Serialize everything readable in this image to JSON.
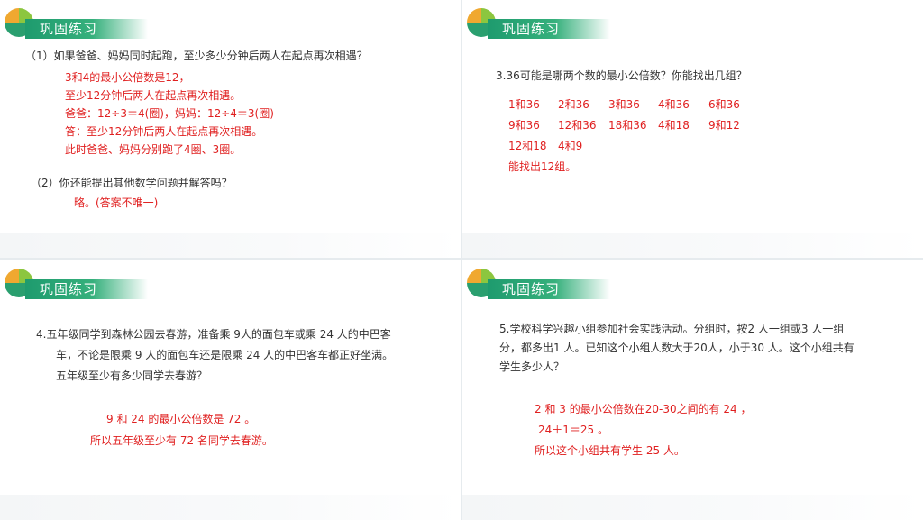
{
  "section_title": "巩固练习",
  "colors": {
    "green": "#2a9f6f",
    "red": "#e02020",
    "text": "#333333"
  },
  "slide1": {
    "q1": "（1）如果爸爸、妈妈同时起跑，至少多少分钟后两人在起点再次相遇？",
    "a1": [
      "3和4的最小公倍数是12，",
      "至少12分钟后两人在起点再次相遇。",
      "爸爸：12÷3＝4(圈)，妈妈：12÷4＝3(圈)",
      "答：至少12分钟后两人在起点再次相遇。",
      "此时爸爸、妈妈分别跑了4圈、3圈。"
    ],
    "q2": "（2）你还能提出其他数学问题并解答吗？",
    "a2": "略。(答案不唯一)"
  },
  "slide2": {
    "q": "3.36可能是哪两个数的最小公倍数？你能找出几组？",
    "pairs": [
      [
        "1和36",
        "2和36",
        "3和36",
        "4和36",
        "6和36"
      ],
      [
        "9和36",
        "12和36",
        "18和36",
        "4和18",
        "9和12"
      ],
      [
        "12和18",
        "4和9"
      ]
    ],
    "conclusion": "能找出12组。"
  },
  "slide3": {
    "q": [
      "4.五年级同学到森林公园去春游，准备乘 9人的面包车或乘 24 人的中巴客",
      "车，不论是限乘 9 人的面包车还是限乘 24 人的中巴客车都正好坐满。",
      "五年级至少有多少同学去春游？"
    ],
    "a": [
      "9 和 24 的最小公倍数是 72 。",
      "所以五年级至少有 72 名同学去春游。"
    ]
  },
  "slide4": {
    "q": [
      "5.学校科学兴趣小组参加社会实践活动。分组时，按2 人一组或3 人一组",
      "分，都多出1 人。已知这个小组人数大于20人，小于30 人。这个小组共有",
      "学生多少人？"
    ],
    "a": [
      "2 和 3 的最小公倍数在20-30之间的有 24 ，",
      "24＋1＝25 。",
      "所以这个小组共有学生 25 人。"
    ]
  }
}
